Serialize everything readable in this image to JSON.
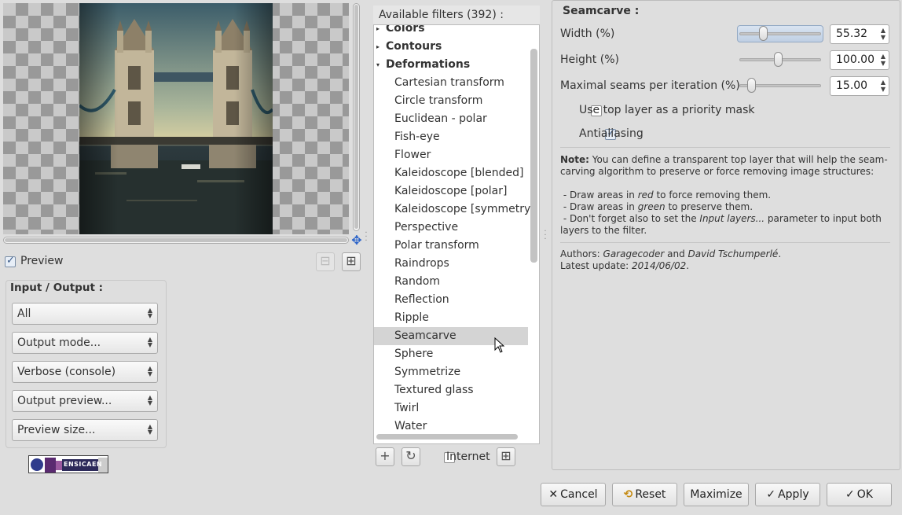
{
  "preview": {
    "checkbox_label": "Preview",
    "checked": true,
    "zoom_out_icon": "zoom-out-icon",
    "zoom_in_icon": "zoom-in-icon",
    "move_icon": "move-cross-icon"
  },
  "io": {
    "title": "Input / Output :",
    "combos": [
      {
        "label": "All"
      },
      {
        "label": "Output mode..."
      },
      {
        "label": "Verbose (console)"
      },
      {
        "label": "Output preview..."
      },
      {
        "label": "Preview size..."
      }
    ]
  },
  "logo": {
    "text": "ENSICAEN",
    "badge": "GREYC"
  },
  "filters": {
    "header": "Available filters (392) :",
    "items": [
      {
        "label": "Colors",
        "kind": "cat",
        "expanded": false
      },
      {
        "label": "Contours",
        "kind": "cat",
        "expanded": false
      },
      {
        "label": "Deformations",
        "kind": "cat",
        "expanded": true
      },
      {
        "label": "Cartesian transform",
        "kind": "sub"
      },
      {
        "label": "Circle transform",
        "kind": "sub"
      },
      {
        "label": "Euclidean - polar",
        "kind": "sub"
      },
      {
        "label": "Fish-eye",
        "kind": "sub"
      },
      {
        "label": "Flower",
        "kind": "sub"
      },
      {
        "label": "Kaleidoscope [blended]",
        "kind": "sub"
      },
      {
        "label": "Kaleidoscope [polar]",
        "kind": "sub"
      },
      {
        "label": "Kaleidoscope [symmetry]",
        "kind": "sub"
      },
      {
        "label": "Perspective",
        "kind": "sub"
      },
      {
        "label": "Polar transform",
        "kind": "sub"
      },
      {
        "label": "Raindrops",
        "kind": "sub"
      },
      {
        "label": "Random",
        "kind": "sub"
      },
      {
        "label": "Reflection",
        "kind": "sub"
      },
      {
        "label": "Ripple",
        "kind": "sub"
      },
      {
        "label": "Seamcarve",
        "kind": "sub",
        "selected": true
      },
      {
        "label": "Sphere",
        "kind": "sub"
      },
      {
        "label": "Symmetrize",
        "kind": "sub"
      },
      {
        "label": "Textured glass",
        "kind": "sub"
      },
      {
        "label": "Twirl",
        "kind": "sub"
      },
      {
        "label": "Water",
        "kind": "sub"
      }
    ],
    "add_icon": "plus-icon",
    "refresh_icon": "refresh-icon",
    "internet_label": "Internet",
    "internet_checked": false,
    "expand_icon": "expand-icon"
  },
  "params": {
    "title": "Seamcarve :",
    "width": {
      "label": "Width (%)",
      "value": "55.32",
      "fraction": 0.3
    },
    "height": {
      "label": "Height (%)",
      "value": "100.00",
      "fraction": 0.48
    },
    "seams": {
      "label": "Maximal seams per iteration (%)",
      "value": "15.00",
      "fraction": 0.15
    },
    "priority_mask": {
      "label": "Use top layer as a priority mask",
      "checked": false
    },
    "antialiasing": {
      "label": "Antialiasing",
      "checked": true
    },
    "note": {
      "prefix": "Note:",
      "text1": "You can define a transparent top layer that will help the seam-carving algorithm to preserve or force removing image structures:",
      "b1a": "- Draw areas in ",
      "b1em": "red",
      "b1b": " to force removing them.",
      "b2a": "- Draw areas in ",
      "b2em": "green",
      "b2b": " to preserve them.",
      "b3a": "- Don't forget also to set the ",
      "b3em": "Input layers...",
      "b3b": " parameter to input both layers to the filter."
    },
    "authors": {
      "prefix": "Authors: ",
      "a1": "Garagecoder",
      "mid": " and ",
      "a2": "David Tschumperlé",
      "end": ".",
      "update_prefix": "Latest update: ",
      "date": "2014/06/02",
      "date_end": "."
    }
  },
  "buttons": {
    "cancel": "Cancel",
    "reset": "Reset",
    "maximize": "Maximize",
    "apply": "Apply",
    "ok": "OK"
  }
}
